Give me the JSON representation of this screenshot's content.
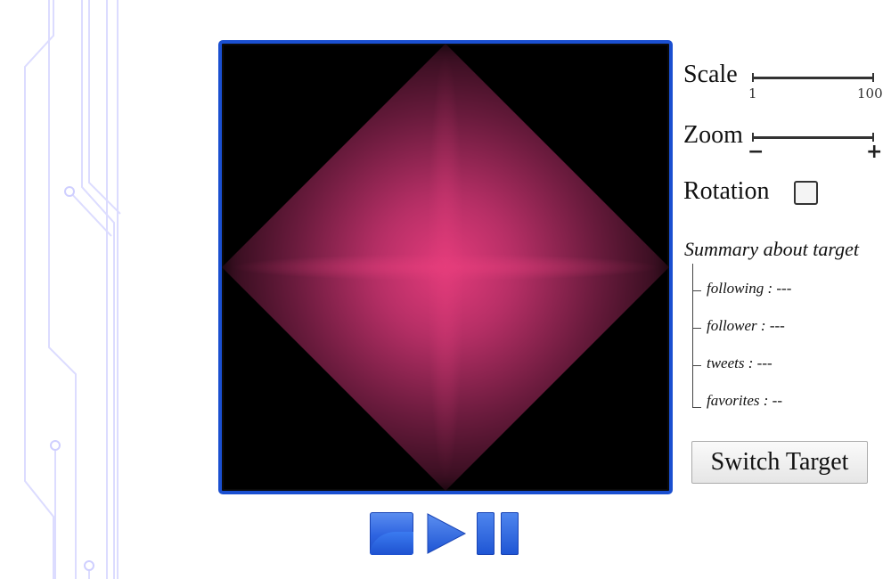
{
  "controls": {
    "scale": {
      "label": "Scale",
      "min_label": "1",
      "max_label": "100"
    },
    "zoom": {
      "label": "Zoom",
      "minus_label": "−",
      "plus_label": "+"
    },
    "rotation": {
      "label": "Rotation",
      "checked": false
    }
  },
  "summary": {
    "title": "Summary about  target",
    "following": "following : ---",
    "follower": "follower : ---",
    "tweets": "tweets : ---",
    "favorites": "favorites : --"
  },
  "switch_button_label": "Switch Target",
  "playback": [
    "stop-icon",
    "play-icon",
    "pause-icon"
  ],
  "colors": {
    "accent": "#1a4fd0",
    "glow": "#e43b7b",
    "background": "#ffffff",
    "circuit": "#d6d6ff"
  }
}
